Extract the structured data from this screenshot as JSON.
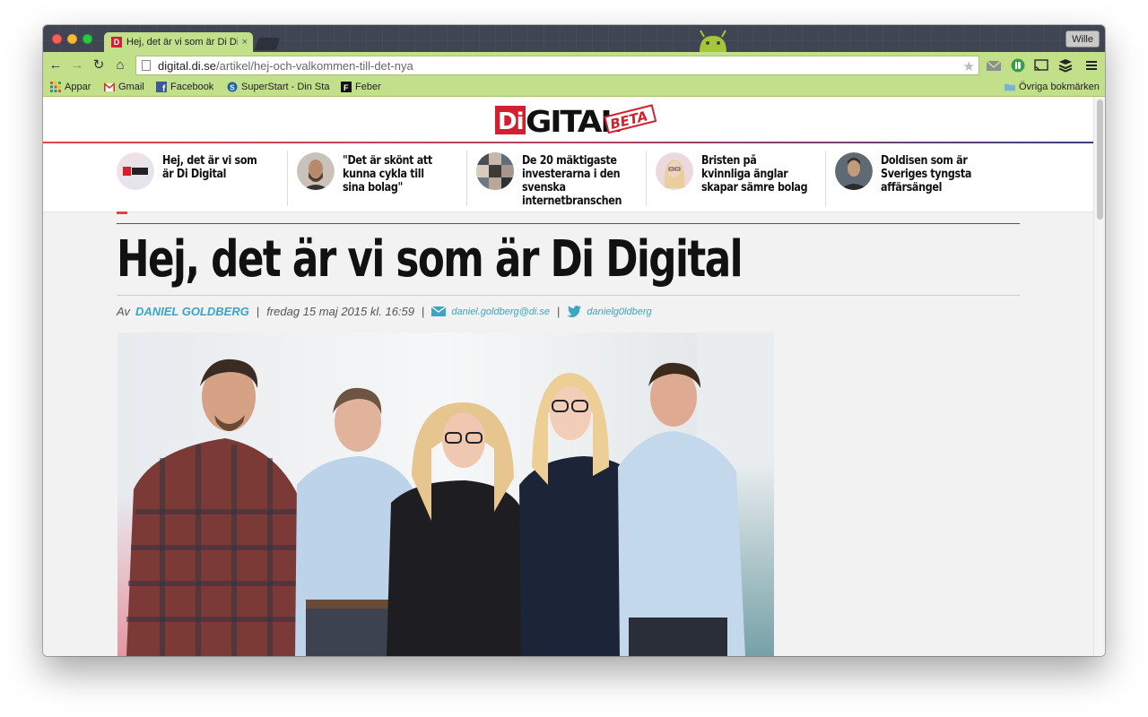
{
  "browser": {
    "tab_title": "Hej, det är vi som är Di Digi",
    "tab_close": "×",
    "profile": "Wille",
    "url_domain": "digital.di.se",
    "url_path": "/artikel/hej-och-valkommen-till-det-nya",
    "favicon_letter": "D"
  },
  "bookmarks": [
    {
      "label": "Appar",
      "icon": "apps-grid-icon"
    },
    {
      "label": "Gmail",
      "icon": "gmail-icon"
    },
    {
      "label": "Facebook",
      "icon": "facebook-icon"
    },
    {
      "label": "SuperStart - Din Sta",
      "icon": "superstart-icon"
    },
    {
      "label": "Feber",
      "icon": "feber-icon"
    },
    {
      "label": "Övriga bokmärken",
      "icon": "folder-icon"
    }
  ],
  "site": {
    "logo_di": "Di",
    "logo_gital": "GITAL",
    "logo_beta": "BETA"
  },
  "strip": [
    {
      "text": "Hej, det är vi som är Di Digital",
      "thumb": "di-digital-logo"
    },
    {
      "text": "\"Det är skönt att kunna cykla till sina bolag\"",
      "thumb": "man-beard"
    },
    {
      "text": "De 20 mäktigaste investerarna i den svenska internetbranschen",
      "thumb": "collage"
    },
    {
      "text": "Bristen på kvinnliga änglar skapar sämre bolag",
      "thumb": "blonde-woman"
    },
    {
      "text": "Doldisen som är Sveriges tyngsta affärsängel",
      "thumb": "man-portrait"
    }
  ],
  "article": {
    "headline": "Hej, det är vi som är Di Digital",
    "by": "Av",
    "author": "DANIEL GOLDBERG",
    "date": "fredag 15 maj 2015 kl. 16:59",
    "email": "daniel.goldberg@di.se",
    "twitter": "danielg0ldberg"
  },
  "colors": {
    "toolbar": "#c2e089",
    "brand_red": "#d3202f",
    "link_blue": "#3aa5c4"
  }
}
